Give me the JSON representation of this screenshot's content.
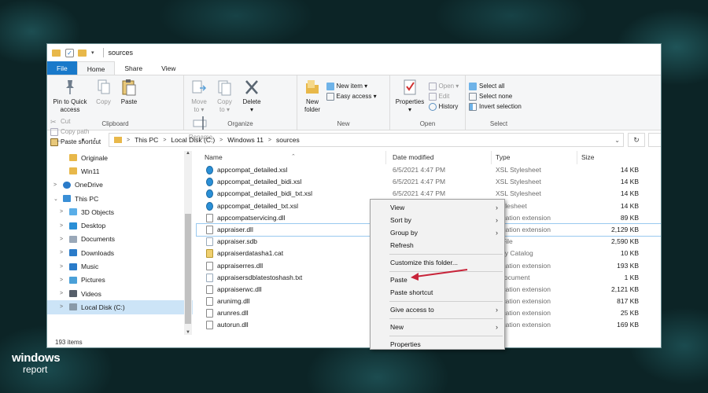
{
  "window": {
    "title": "sources",
    "ribbon_tabs": [
      "File",
      "Home",
      "Share",
      "View"
    ],
    "ribbon": {
      "clipboard": {
        "label": "Clipboard",
        "pin": [
          "Pin to Quick",
          "access"
        ],
        "copy": "Copy",
        "paste": "Paste",
        "cut": "Cut",
        "copy_path": "Copy path",
        "paste_shortcut": "Paste shortcut"
      },
      "organize": {
        "label": "Organize",
        "move_to": [
          "Move",
          "to ▾"
        ],
        "copy_to": [
          "Copy",
          "to ▾"
        ],
        "delete": [
          "Delete",
          "▾"
        ],
        "rename": "Rename"
      },
      "new": {
        "label": "New",
        "new_folder": [
          "New",
          "folder"
        ],
        "new_item": "New item ▾",
        "easy_access": "Easy access ▾"
      },
      "open": {
        "label": "Open",
        "properties": [
          "Properties",
          "▾"
        ],
        "open": "Open ▾",
        "edit": "Edit",
        "history": "History"
      },
      "select": {
        "label": "Select",
        "select_all": "Select all",
        "select_none": "Select none",
        "invert": "Invert selection"
      }
    },
    "address": {
      "crumbs": [
        "This PC",
        "Local Disk (C:)",
        "Windows 11",
        "sources"
      ]
    },
    "nav_pane": [
      {
        "label": "Originale",
        "icon": "folder-icon",
        "color": "#e8b84a"
      },
      {
        "label": "Win11",
        "icon": "folder-icon",
        "color": "#e8b84a"
      },
      {
        "label": "OneDrive",
        "icon": "cloud-icon",
        "color": "#2a7bc9"
      },
      {
        "label": "This PC",
        "icon": "pc-icon",
        "color": "#3a8fd6"
      },
      {
        "label": "3D Objects",
        "icon": "cube-icon",
        "color": "#5aaee8"
      },
      {
        "label": "Desktop",
        "icon": "desktop-icon",
        "color": "#2a8fd6"
      },
      {
        "label": "Documents",
        "icon": "documents-icon",
        "color": "#9aa8b8"
      },
      {
        "label": "Downloads",
        "icon": "download-icon",
        "color": "#2a7bc9"
      },
      {
        "label": "Music",
        "icon": "music-icon",
        "color": "#2a7bc9"
      },
      {
        "label": "Pictures",
        "icon": "pictures-icon",
        "color": "#4aa0d8"
      },
      {
        "label": "Videos",
        "icon": "videos-icon",
        "color": "#555e6a"
      },
      {
        "label": "Local Disk (C:)",
        "icon": "drive-icon",
        "color": "#8a9aa8"
      }
    ],
    "columns": [
      "Name",
      "Date modified",
      "Type",
      "Size"
    ],
    "files": [
      {
        "name": "appcompat_detailed.xsl",
        "date": "6/5/2021 4:47 PM",
        "type": "XSL Stylesheet",
        "size": "14 KB",
        "icon": "xsl"
      },
      {
        "name": "appcompat_detailed_bidi.xsl",
        "date": "6/5/2021 4:47 PM",
        "type": "XSL Stylesheet",
        "size": "14 KB",
        "icon": "xsl"
      },
      {
        "name": "appcompat_detailed_bidi_txt.xsl",
        "date": "6/5/2021 4:47 PM",
        "type": "XSL Stylesheet",
        "size": "14 KB",
        "icon": "xsl"
      },
      {
        "name": "appcompat_detailed_txt.xsl",
        "date": "",
        "type": "Stylesheet",
        "size": "14 KB",
        "icon": "xsl"
      },
      {
        "name": "appcompatservicing.dll",
        "date": "",
        "type": "plication extension",
        "size": "89 KB",
        "icon": "dll"
      },
      {
        "name": "appraiser.dll",
        "date": "",
        "type": "plication extension",
        "size": "2,129 KB",
        "icon": "dll"
      },
      {
        "name": "appraiser.sdb",
        "date": "",
        "type": "B File",
        "size": "2,590 KB",
        "icon": "file"
      },
      {
        "name": "appraiserdatasha1.cat",
        "date": "",
        "type": "urity Catalog",
        "size": "10 KB",
        "icon": "cat"
      },
      {
        "name": "appraiserres.dll",
        "date": "",
        "type": "plication extension",
        "size": "193 KB",
        "icon": "dll"
      },
      {
        "name": "appraisersdblatestoshash.txt",
        "date": "",
        "type": "t Document",
        "size": "1 KB",
        "icon": "file"
      },
      {
        "name": "appraiserwc.dll",
        "date": "",
        "type": "plication extension",
        "size": "2,121 KB",
        "icon": "dll"
      },
      {
        "name": "arunimg.dll",
        "date": "",
        "type": "plication extension",
        "size": "817 KB",
        "icon": "dll"
      },
      {
        "name": "arunres.dll",
        "date": "",
        "type": "plication extension",
        "size": "25 KB",
        "icon": "dll"
      },
      {
        "name": "autorun.dll",
        "date": "",
        "type": "plication extension",
        "size": "169 KB",
        "icon": "dll"
      }
    ],
    "status": "193 items"
  },
  "context_menu": [
    {
      "label": "View",
      "submenu": true
    },
    {
      "label": "Sort by",
      "submenu": true
    },
    {
      "label": "Group by",
      "submenu": true
    },
    {
      "label": "Refresh",
      "submenu": false
    },
    {
      "sep": true
    },
    {
      "label": "Customize this folder...",
      "submenu": false
    },
    {
      "sep": true
    },
    {
      "label": "Paste",
      "submenu": false
    },
    {
      "label": "Paste shortcut",
      "submenu": false
    },
    {
      "sep": true
    },
    {
      "label": "Give access to",
      "submenu": true
    },
    {
      "sep": true
    },
    {
      "label": "New",
      "submenu": true
    },
    {
      "sep": true
    },
    {
      "label": "Properties",
      "submenu": false
    }
  ],
  "logo": {
    "line1": "windows",
    "line2": "report"
  },
  "colors": {
    "accent": "#1979ca",
    "arrow": "#c8243a"
  }
}
